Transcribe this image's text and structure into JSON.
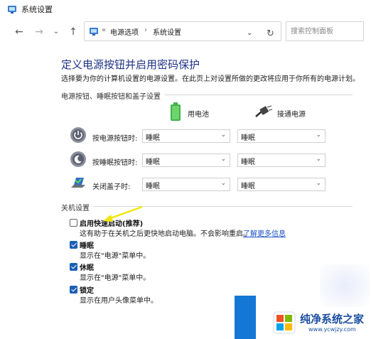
{
  "window": {
    "title": "系统设置"
  },
  "nav": {
    "back_icon": "back-arrow-icon",
    "forward_icon": "forward-arrow-icon",
    "dropdown_icon": "chevron-down-icon",
    "up_icon": "up-arrow-icon",
    "breadcrumb_lead": "«",
    "breadcrumb": [
      "电源选项",
      "系统设置"
    ],
    "crumb_sep": "›",
    "refresh_icon": "refresh-icon",
    "search_placeholder": "搜索控制面板"
  },
  "page": {
    "heading": "定义电源按钮并启用密码保护",
    "subtitle": "选择要为你的计算机设置的电源设置。在此页上对设置所做的更改将应用于你所有的电源计划。"
  },
  "power_section": {
    "label": "电源按钮、睡眠按钮和盖子设置",
    "col_battery": "用电池",
    "col_plugged": "接通电源",
    "rows": [
      {
        "label": "按电源按钮时:",
        "battery": "睡眠",
        "plugged": "睡眠",
        "icon": "power-button-icon"
      },
      {
        "label": "按睡眠按钮时:",
        "battery": "睡眠",
        "plugged": "睡眠",
        "icon": "sleep-button-icon"
      },
      {
        "label": "关闭盖子时:",
        "battery": "睡眠",
        "plugged": "睡眠",
        "icon": "laptop-lid-icon"
      }
    ]
  },
  "shutdown_section": {
    "label": "关机设置",
    "options": [
      {
        "title": "启用快速启动(推荐)",
        "desc": "这有助于在关机之后更快地启动电脑。不会影响重启。",
        "link": "了解更多信息",
        "checked": false
      },
      {
        "title": "睡眠",
        "desc": "显示在\"电源\"菜单中。",
        "checked": true
      },
      {
        "title": "休眠",
        "desc": "显示在\"电源\"菜单中。",
        "checked": true
      },
      {
        "title": "锁定",
        "desc": "显示在用户头像菜单中。",
        "checked": true
      }
    ]
  },
  "watermark": {
    "title": "纯净系统之家",
    "url": "www.ycwjzy.com"
  },
  "colors": {
    "heading": "#1e3287",
    "accent": "#1a5fb4",
    "link": "#1c52c7",
    "arrow": "#f2e600"
  }
}
